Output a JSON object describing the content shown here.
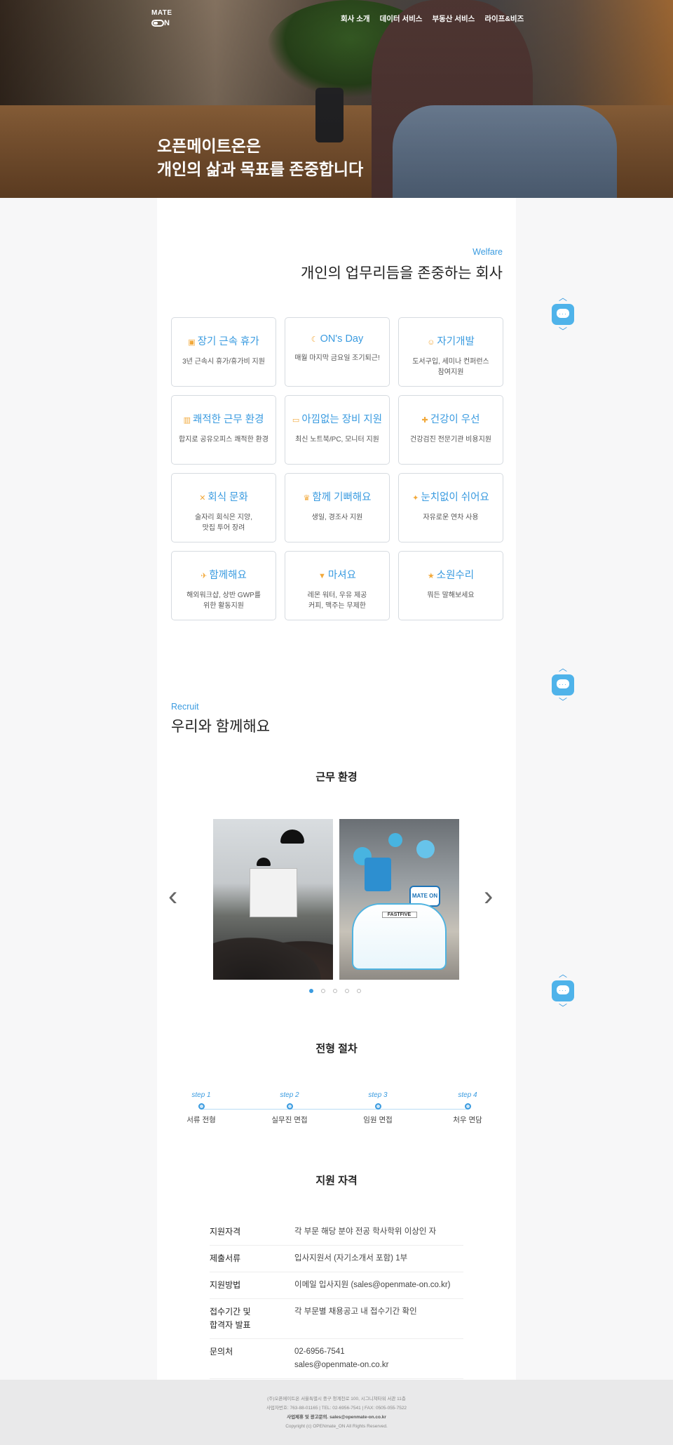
{
  "header": {
    "logo_top": "MATE",
    "logo_bottom": "N",
    "nav": [
      "회사 소개",
      "데이터 서비스",
      "부동산 서비스",
      "라이프&비즈"
    ],
    "hero_line1": "오픈메이트온은",
    "hero_line2": "개인의 삶과 목표를 존중합니다"
  },
  "welfare": {
    "label": "Welfare",
    "title": "개인의 업무리듬을 존중하는 회사",
    "cards": [
      {
        "icon": "calendar-icon",
        "glyph": "▣",
        "title": "장기 근속 휴가",
        "desc": "3년 근속시 휴가/휴가비 지원"
      },
      {
        "icon": "moon-icon",
        "glyph": "☾",
        "title": "ON's Day",
        "desc": "매월 마지막 금요일 조기퇴근!"
      },
      {
        "icon": "smile-icon",
        "glyph": "☺",
        "title": "자기개발",
        "desc": "도서구입, 세미나 컨퍼런스\n참여지원"
      },
      {
        "icon": "building-icon",
        "glyph": "▥",
        "title": "쾌적한 근무 환경",
        "desc": "합지로 공유오피스 쾌적한 환경"
      },
      {
        "icon": "laptop-icon",
        "glyph": "▭",
        "title": "아낌없는 장비 지원",
        "desc": "최신 노트북/PC, 모니터 지원"
      },
      {
        "icon": "health-plus-icon",
        "glyph": "✚",
        "title": "건강이 우선",
        "desc": "건강검진 전문기관 비용지원"
      },
      {
        "icon": "fork-knife-icon",
        "glyph": "✕",
        "title": "회식 문화",
        "desc": "술자리 회식은 지양,\n맛집 투어 장려"
      },
      {
        "icon": "cake-icon",
        "glyph": "♛",
        "title": "함께 기뻐해요",
        "desc": "생일, 경조사 지원"
      },
      {
        "icon": "running-icon",
        "glyph": "✦",
        "title": "눈치없이 쉬어요",
        "desc": "자유로운 연차 사용"
      },
      {
        "icon": "airplane-icon",
        "glyph": "✈",
        "title": "함께해요",
        "desc": "해외워크샵, 상반 GWP를\n위한 활동지원"
      },
      {
        "icon": "cocktail-icon",
        "glyph": "▼",
        "title": "마셔요",
        "desc": "레몬 워터, 우유 제공\n커피, 맥주는 무제한"
      },
      {
        "icon": "star-icon",
        "glyph": "★",
        "title": "소원수리",
        "desc": "뭐든 말해보세요"
      }
    ]
  },
  "recruit": {
    "label": "Recruit",
    "title": "우리와 함께해요",
    "env_title": "근무 환경",
    "process_title": "전형 절차",
    "steps": [
      {
        "label": "step 1",
        "name": "서류 전형"
      },
      {
        "label": "step 2",
        "name": "실무진 면접"
      },
      {
        "label": "step 3",
        "name": "임원 면접"
      },
      {
        "label": "step 4",
        "name": "처우 면담"
      }
    ],
    "qual_title": "지원 자격",
    "qualifications": [
      {
        "k": "지원자격",
        "v": "각 부문 해당 분야 전공 학사학위 이상인 자"
      },
      {
        "k": "제출서류",
        "v": "입사지원서 (자기소개서 포함)  1부"
      },
      {
        "k": "지원방법",
        "v": "이메일 입사지원 (sales@openmate-on.co.kr)"
      },
      {
        "k": "접수기간 및\n합격자 발표",
        "v": "각 부문별 채용공고 내 접수기간 확인"
      },
      {
        "k": "문의처",
        "v": "02-6956-7541\nsales@openmate-on.co.kr"
      }
    ]
  },
  "carousel": {
    "active_index": 0,
    "count": 5,
    "photo2_sign": "MATE ON",
    "photo2_banner": "FASTFIVE"
  },
  "footer": {
    "line1": "(주)오픈메이트온 서울특별시 중구 청계천로 100, 시그니쳐타워 서관 11층",
    "line2": "사업자번호: 763-88-01165  |  TEL: 02-6956-7541  |  FAX: 0505-055-7522",
    "line3": "사업제휴 및 광고문의. sales@openmate-on.co.kr",
    "line4": "Copyright (c) OPENmate_ON All Rights Reserved."
  },
  "colors": {
    "accent": "#3a9be0",
    "icon_orange": "#f2a93b"
  }
}
